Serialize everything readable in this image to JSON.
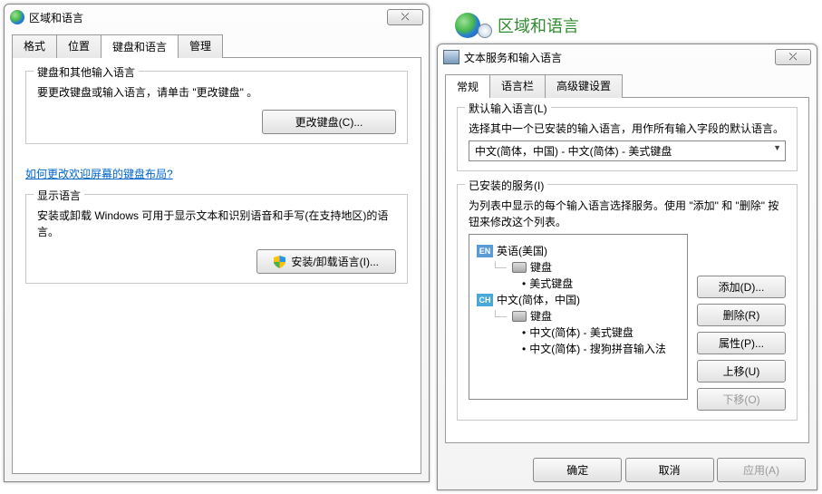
{
  "leftDialog": {
    "title": "区域和语言",
    "closeGlyph": "⤫",
    "tabs": {
      "format": "格式",
      "location": "位置",
      "keyboards": "键盘和语言",
      "admin": "管理"
    },
    "group1": {
      "title": "键盘和其他输入语言",
      "desc": "要更改键盘或输入语言，请单击 \"更改键盘\" 。",
      "btn": "更改键盘(C)..."
    },
    "link": "如何更改欢迎屏幕的键盘布局?",
    "group2": {
      "title": "显示语言",
      "desc": "安装或卸载 Windows 可用于显示文本和识别语音和手写(在支持地区)的语言。",
      "btn": "安装/卸载语言(I)..."
    }
  },
  "cp": {
    "title": "区域和语言"
  },
  "rightDialog": {
    "title": "文本服务和输入语言",
    "closeGlyph": "⤫",
    "tabs": {
      "general": "常规",
      "langbar": "语言栏",
      "advanced": "高级键设置"
    },
    "groupDefault": {
      "title": "默认输入语言(L)",
      "desc": "选择其中一个已安装的输入语言，用作所有输入字段的默认语言。",
      "selected": "中文(简体，中国) - 中文(简体) - 美式键盘"
    },
    "groupInstalled": {
      "title": "已安装的服务(I)",
      "desc": "为列表中显示的每个输入语言选择服务。使用 \"添加\" 和 \"删除\" 按钮来修改这个列表。",
      "en": {
        "badge": "EN",
        "name": "英语(美国)",
        "kb": "键盘",
        "item1": "美式键盘"
      },
      "cn": {
        "badge": "CH",
        "name": "中文(简体，中国)",
        "kb": "键盘",
        "item1": "中文(简体) - 美式键盘",
        "item2": "中文(简体) - 搜狗拼音输入法"
      }
    },
    "sideBtns": {
      "add": "添加(D)...",
      "remove": "删除(R)",
      "props": "属性(P)...",
      "up": "上移(U)",
      "down": "下移(O)"
    },
    "bottom": {
      "ok": "确定",
      "cancel": "取消",
      "apply": "应用(A)"
    }
  }
}
